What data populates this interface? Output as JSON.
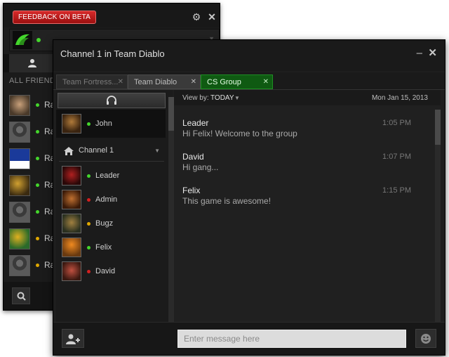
{
  "back_window": {
    "feedback_label": "FEEDBACK ON BETA",
    "settings_icon": "gear-icon",
    "close_icon": "close-icon",
    "brand_icon": "razer-logo-icon",
    "all_friends_label": "ALL FRIENDS",
    "friends": [
      {
        "name": "Ra",
        "status": "online",
        "avatar": "bearded-man"
      },
      {
        "name": "Ra",
        "status": "online",
        "avatar": "default-silhouette"
      },
      {
        "name": "Ra",
        "status": "online",
        "avatar": "fitness-logo"
      },
      {
        "name": "Ra",
        "status": "online",
        "avatar": "warrior"
      },
      {
        "name": "Ra",
        "status": "online",
        "avatar": "default-silhouette"
      },
      {
        "name": "Ra",
        "status": "away",
        "avatar": "flowers"
      },
      {
        "name": "Ra",
        "status": "away",
        "avatar": "default-silhouette"
      }
    ],
    "search_icon": "search-icon"
  },
  "chat_window": {
    "title": "Channel 1 in Team Diablo",
    "tabs": [
      {
        "label": "Team Fortress...",
        "state": "inactive"
      },
      {
        "label": "Team Diablo",
        "state": "inactive"
      },
      {
        "label": "CS Group",
        "state": "active"
      }
    ],
    "voice_icon": "headset-icon",
    "voice_user": {
      "name": "John",
      "status": "online"
    },
    "channel_label": "Channel 1",
    "members": [
      {
        "name": "Leader",
        "status": "online",
        "avatar": "demon"
      },
      {
        "name": "Admin",
        "status": "busy",
        "avatar": "armored-hero"
      },
      {
        "name": "Bugz",
        "status": "away",
        "avatar": "creature"
      },
      {
        "name": "Felix",
        "status": "online",
        "avatar": "orange-helmet"
      },
      {
        "name": "David",
        "status": "busy",
        "avatar": "red-face"
      }
    ],
    "view_by_label": "View by:",
    "view_by_value": "TODAY",
    "date": "Mon Jan 15, 2013",
    "messages": [
      {
        "sender": "Leader",
        "text": "Hi Felix! Welcome to the group",
        "time": "1:05 PM"
      },
      {
        "sender": "David",
        "text": "Hi gang...",
        "time": "1:07 PM"
      },
      {
        "sender": "Felix",
        "text": "This game is awesome!",
        "time": "1:15 PM"
      }
    ],
    "input_placeholder": "Enter message here"
  },
  "colors": {
    "online": "#44d62c",
    "away": "#e0a800",
    "busy": "#d32020",
    "accent_green": "#0f5a12",
    "feedback_red": "#c31b1b"
  }
}
